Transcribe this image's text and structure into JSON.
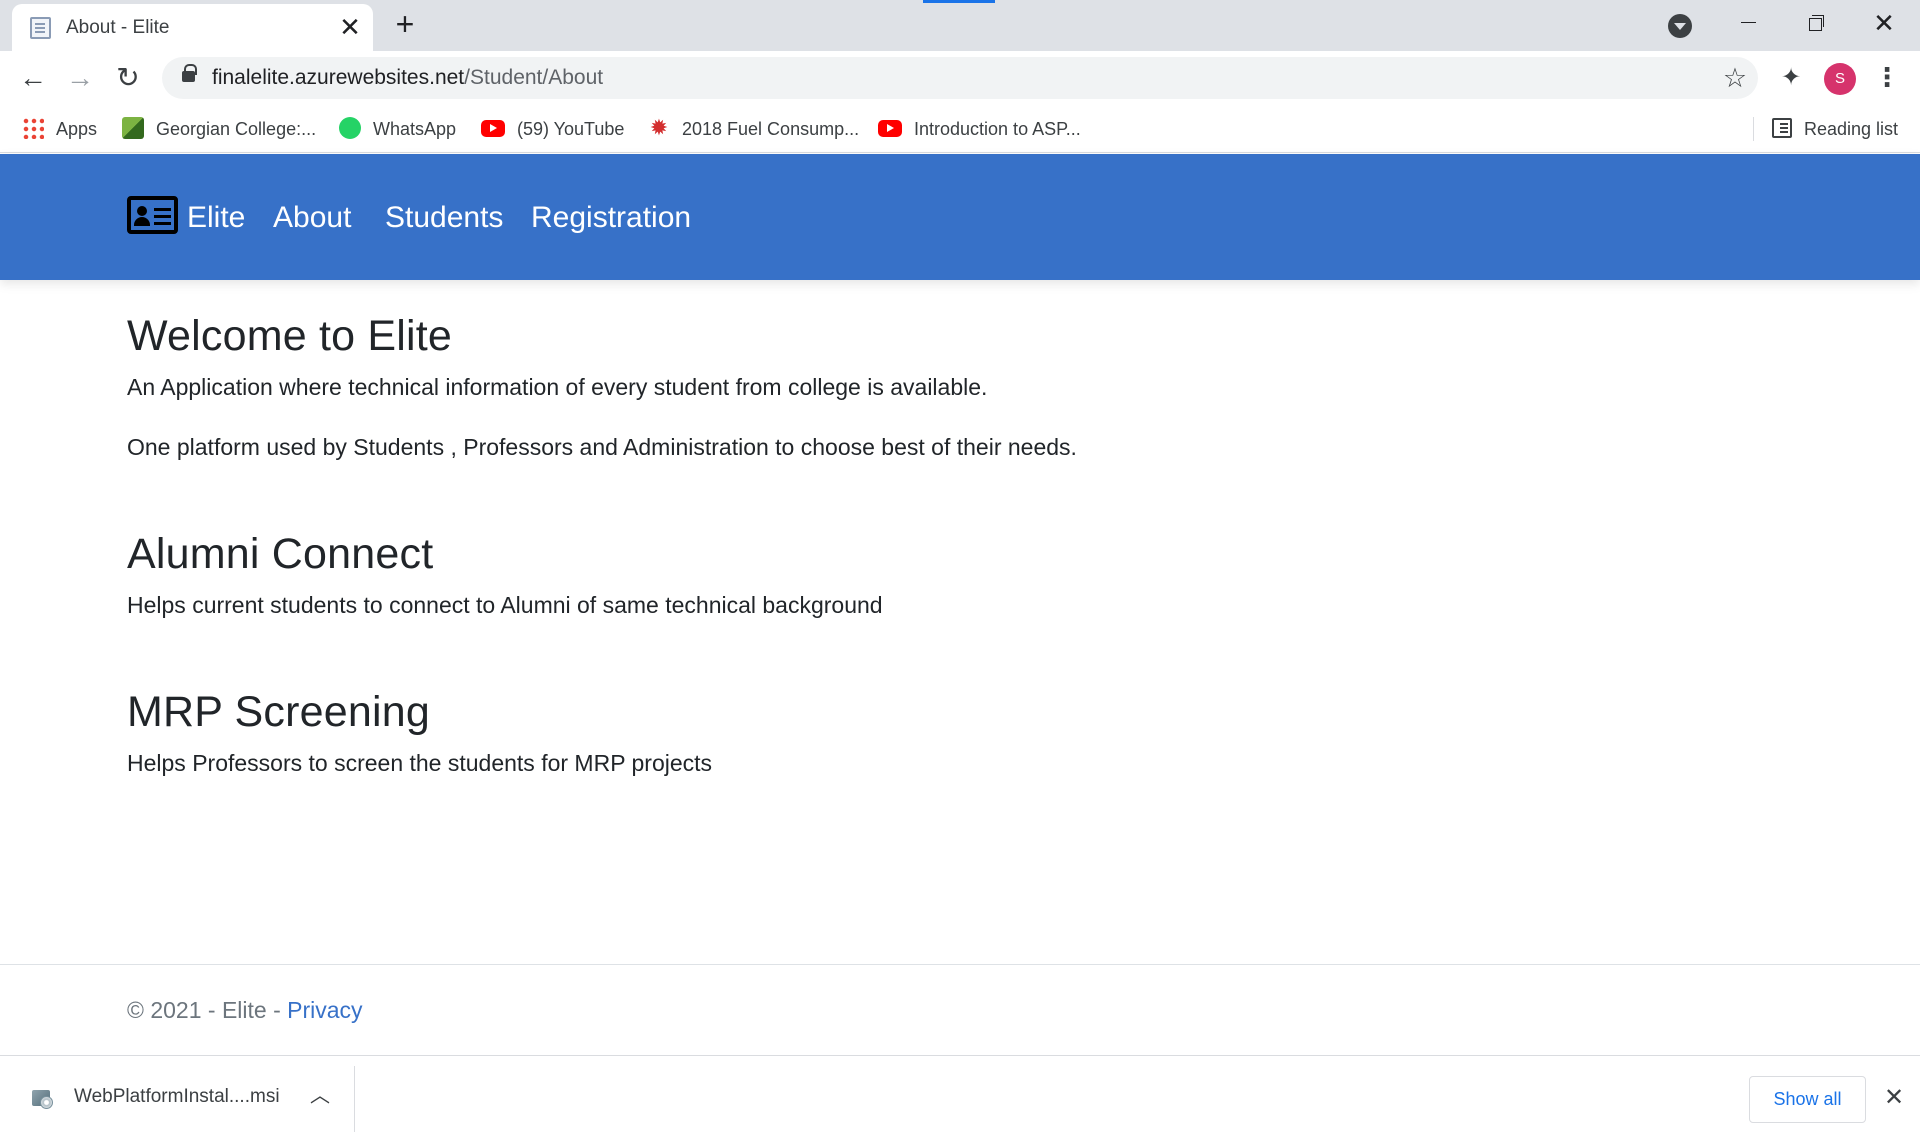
{
  "browser": {
    "tab": {
      "title": "About - Elite",
      "close_glyph": "✕"
    },
    "new_tab_glyph": "+",
    "address": {
      "host": "finalelite.azurewebsites.net",
      "path": "/Student/About"
    },
    "profile_initial": "S",
    "bookmarks": [
      {
        "label": "Apps",
        "icon": "apps-grid-icon"
      },
      {
        "label": "Georgian College:...",
        "icon": "georgian-college-icon"
      },
      {
        "label": "WhatsApp",
        "icon": "whatsapp-icon"
      },
      {
        "label": "(59) YouTube",
        "icon": "youtube-icon"
      },
      {
        "label": "2018 Fuel Consump...",
        "icon": "canada-maple-leaf-icon"
      },
      {
        "label": "Introduction to ASP...",
        "icon": "youtube-icon"
      }
    ],
    "reading_list": "Reading list"
  },
  "site": {
    "brand": "Elite",
    "nav": [
      "About",
      "Students",
      "Registration"
    ],
    "colors": {
      "navbar": "#3771c8",
      "link": "#3771c8",
      "text": "#212529",
      "muted": "#6c757d"
    }
  },
  "main": {
    "welcome": {
      "heading": "Welcome to Elite",
      "paragraphs": [
        "An Application where technical information of every student from college is available.",
        "One platform used by Students , Professors and Administration to choose best of their needs."
      ]
    },
    "alumni": {
      "heading": "Alumni Connect",
      "text": "Helps current students to connect to Alumni of same technical background"
    },
    "mrp": {
      "heading": "MRP Screening",
      "text": "Helps Professors to screen the students for MRP projects"
    }
  },
  "footer": {
    "copyright": "© 2021 - Elite - ",
    "privacy_link": "Privacy"
  },
  "downloads": {
    "file_name": "WebPlatformInstal....msi",
    "show_all": "Show all"
  }
}
